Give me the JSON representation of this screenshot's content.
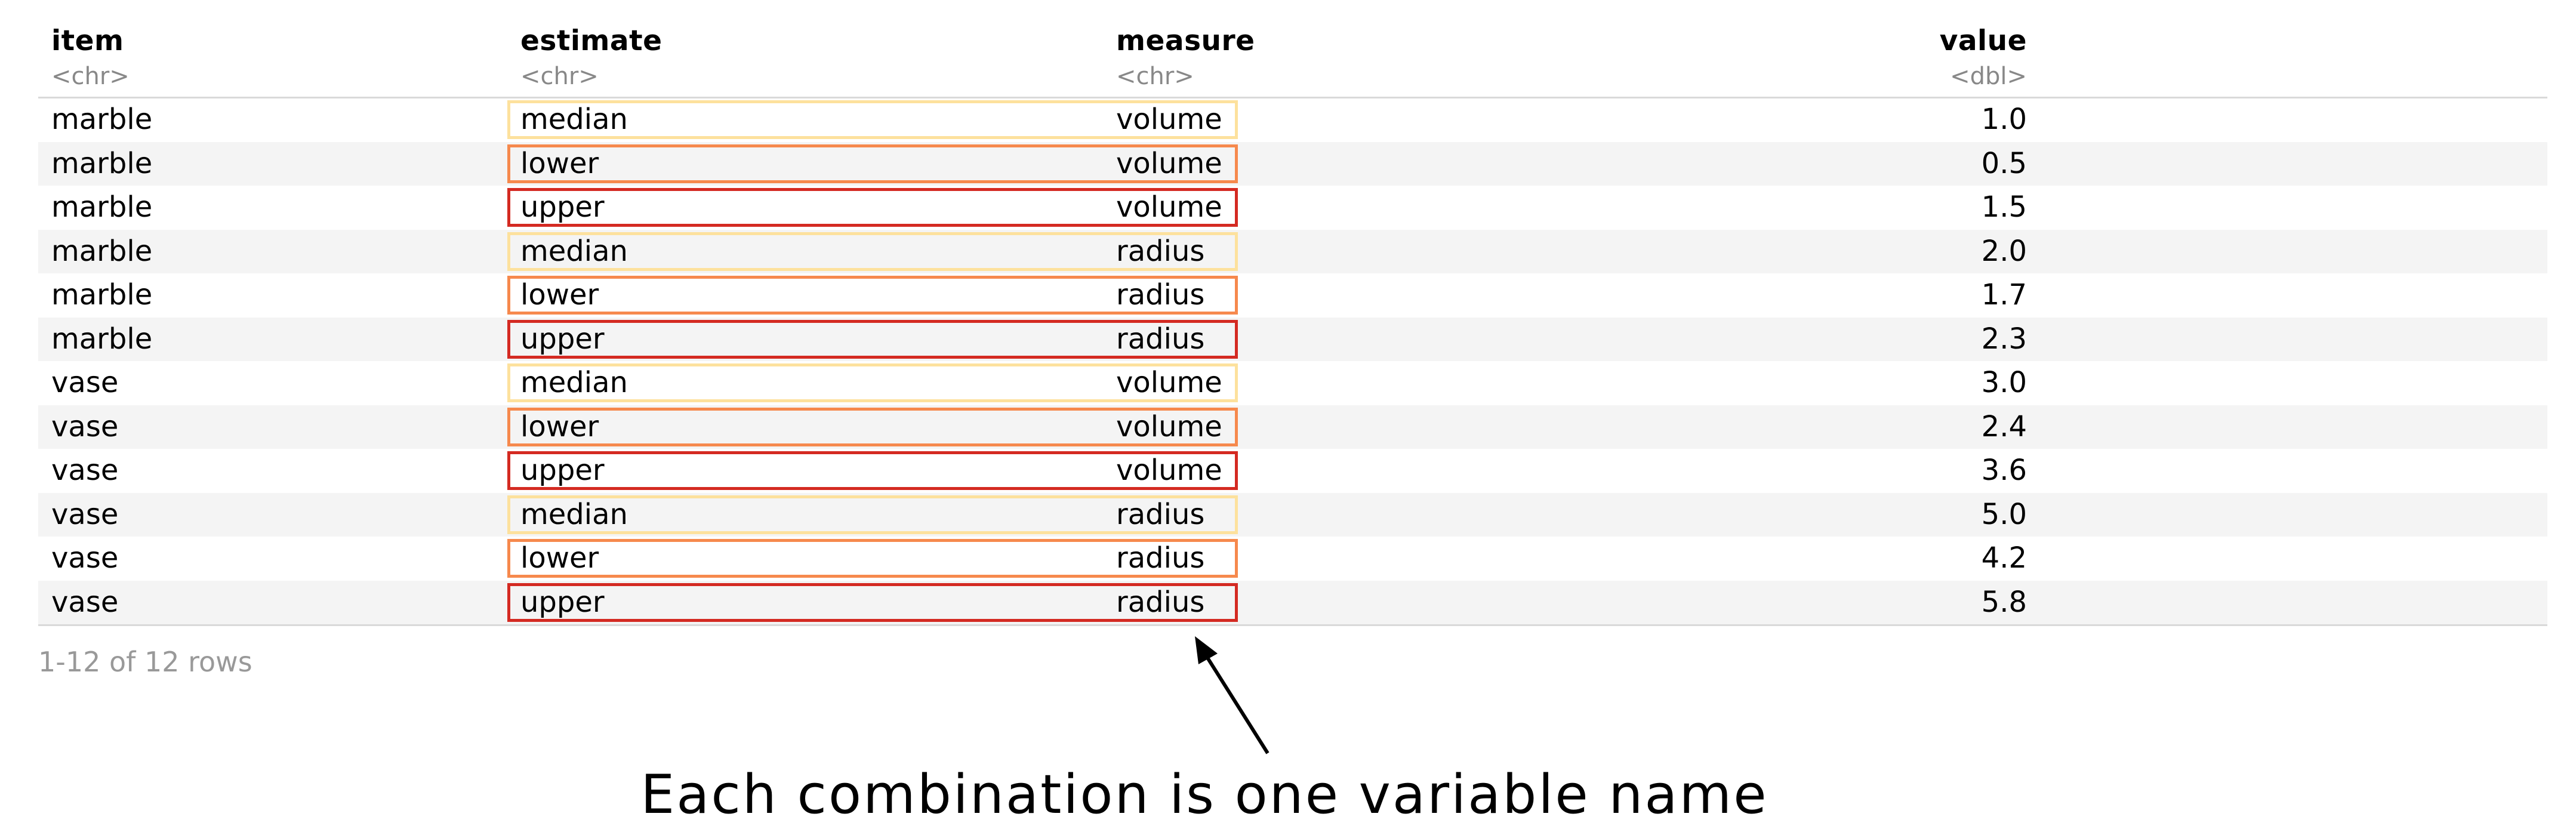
{
  "table": {
    "columns": [
      {
        "name": "item",
        "type": "<chr>"
      },
      {
        "name": "estimate",
        "type": "<chr>"
      },
      {
        "name": "measure",
        "type": "<chr>"
      },
      {
        "name": "value",
        "type": "<dbl>"
      }
    ],
    "rows": [
      {
        "item": "marble",
        "estimate": "median",
        "measure": "volume",
        "value": "1.0"
      },
      {
        "item": "marble",
        "estimate": "lower",
        "measure": "volume",
        "value": "0.5"
      },
      {
        "item": "marble",
        "estimate": "upper",
        "measure": "volume",
        "value": "1.5"
      },
      {
        "item": "marble",
        "estimate": "median",
        "measure": "radius",
        "value": "2.0"
      },
      {
        "item": "marble",
        "estimate": "lower",
        "measure": "radius",
        "value": "1.7"
      },
      {
        "item": "marble",
        "estimate": "upper",
        "measure": "radius",
        "value": "2.3"
      },
      {
        "item": "vase",
        "estimate": "median",
        "measure": "volume",
        "value": "3.0"
      },
      {
        "item": "vase",
        "estimate": "lower",
        "measure": "volume",
        "value": "2.4"
      },
      {
        "item": "vase",
        "estimate": "upper",
        "measure": "volume",
        "value": "3.6"
      },
      {
        "item": "vase",
        "estimate": "median",
        "measure": "radius",
        "value": "5.0"
      },
      {
        "item": "vase",
        "estimate": "lower",
        "measure": "radius",
        "value": "4.2"
      },
      {
        "item": "vase",
        "estimate": "upper",
        "measure": "radius",
        "value": "5.8"
      }
    ],
    "footer": "1-12 of 12 rows"
  },
  "highlight_colors": {
    "median": "#fde19d",
    "lower": "#f6894d",
    "upper": "#d42a22"
  },
  "annotation": {
    "caption": "Each combination is one variable name"
  }
}
